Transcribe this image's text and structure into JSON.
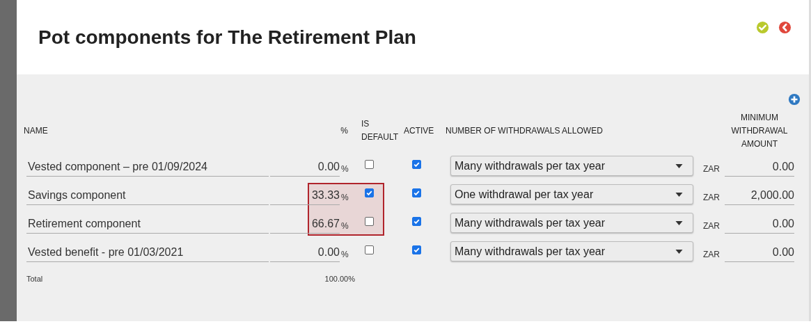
{
  "title": "Pot components for The Retirement Plan",
  "columns": {
    "name": "NAME",
    "percent": "%",
    "is_default": "IS DEFAULT",
    "active": "ACTIVE",
    "withdrawals": "NUMBER OF WITHDRAWALS ALLOWED",
    "minimum": "MINIMUM WITHDRAWAL AMOUNT"
  },
  "rows": [
    {
      "name": "Vested component – pre 01/09/2024",
      "percent": "0.00",
      "percent_sign": "%",
      "is_default": false,
      "active": true,
      "withdrawals": "Many withdrawals per tax year",
      "currency": "ZAR",
      "minimum": "0.00",
      "highlighted": false
    },
    {
      "name": "Savings component",
      "percent": "33.33",
      "percent_sign": "%",
      "is_default": true,
      "active": true,
      "withdrawals": "One withdrawal per tax year",
      "currency": "ZAR",
      "minimum": "2,000.00",
      "highlighted": true
    },
    {
      "name": "Retirement component",
      "percent": "66.67",
      "percent_sign": "%",
      "is_default": false,
      "active": true,
      "withdrawals": "Many withdrawals per tax year",
      "currency": "ZAR",
      "minimum": "0.00",
      "highlighted": true
    },
    {
      "name": "Vested benefit - pre 01/03/2021",
      "percent": "0.00",
      "percent_sign": "%",
      "is_default": false,
      "active": true,
      "withdrawals": "Many withdrawals per tax year",
      "currency": "ZAR",
      "minimum": "0.00",
      "highlighted": false
    }
  ],
  "total": {
    "label": "Total",
    "value": "100.00%"
  }
}
